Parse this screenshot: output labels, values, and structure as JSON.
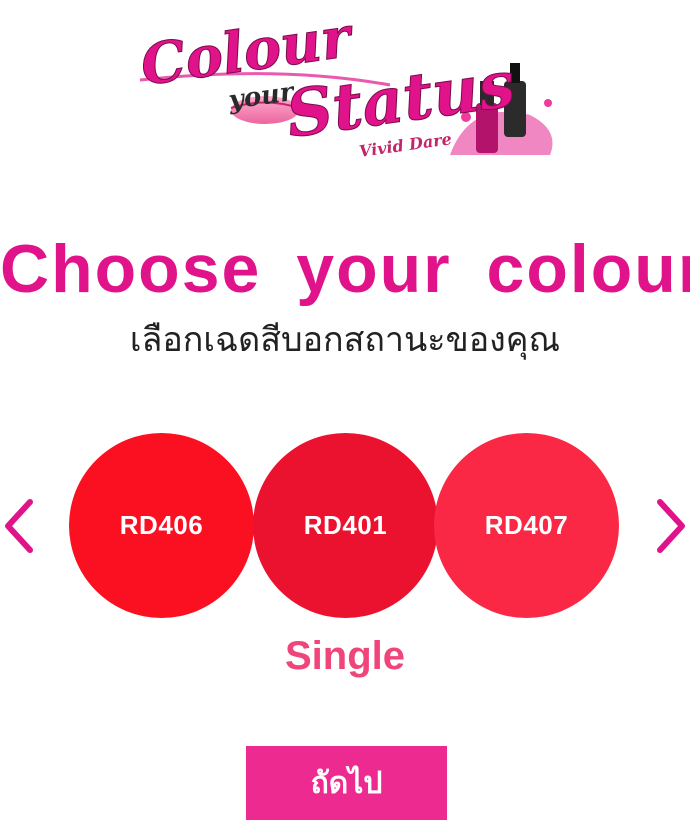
{
  "logo": {
    "word_colour": "Colour",
    "word_your": "your",
    "word_status": "Status",
    "tagline": "Vivid Dare"
  },
  "heading": {
    "title": "Choose your colour",
    "subtitle": "เลือกเฉดสีบอกสถานะของคุณ"
  },
  "carousel": {
    "prev_icon": "chevron-left-icon",
    "next_icon": "chevron-right-icon",
    "arrow_color": "#e0138a",
    "swatches": [
      {
        "code": "RD406",
        "color": "#fa1020"
      },
      {
        "code": "RD401",
        "color": "#eb1230"
      },
      {
        "code": "RD407",
        "color": "#fa2844"
      }
    ],
    "mode": "Single"
  },
  "next_button": {
    "label": "ถัดไป",
    "color": "#ed2a8f"
  },
  "colors": {
    "accent": "#e0138a",
    "mode_text": "#f0457a"
  }
}
